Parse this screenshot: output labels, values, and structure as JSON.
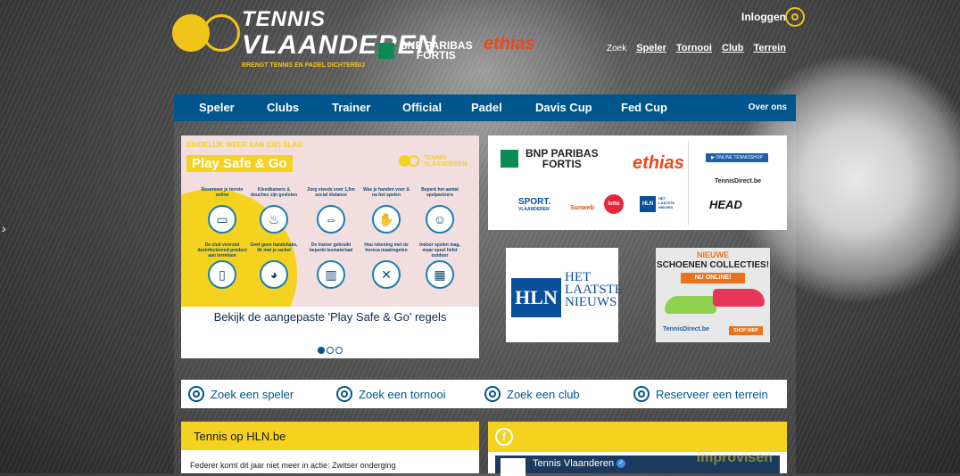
{
  "header": {
    "logo": {
      "line1": "TENNIS",
      "line2": "VLAANDEREN",
      "tagline": "BRENGT TENNIS EN PADEL DICHTERBIJ"
    },
    "sponsor_bnp": {
      "line1": "BNP PARIBAS",
      "line2": "FORTIS"
    },
    "sponsor_ethias": "ethias",
    "login_label": "Inloggen",
    "search_label": "Zoek",
    "search_links": [
      "Speler",
      "Tornooi",
      "Club",
      "Terrein"
    ]
  },
  "nav": {
    "items": [
      "Speler",
      "Clubs",
      "Trainer",
      "Official",
      "Padel",
      "Davis Cup",
      "Fed Cup"
    ],
    "right": "Over ons"
  },
  "slider": {
    "kicker": "EINDELIJK WEER AAN (DE) SLAG",
    "title": "Play Safe & Go",
    "logo_text": [
      "TENNIS",
      "VLAANDEREN"
    ],
    "icons": [
      {
        "caption": "Reserveer je terrein online",
        "icon": "screen-icon"
      },
      {
        "caption": "Kleedkamers & douches zijn gesloten",
        "icon": "shower-icon"
      },
      {
        "caption": "Zorg steeds voor 1,5m social distance",
        "icon": "distance-icon"
      },
      {
        "caption": "Was je handen voor & na het spelen",
        "icon": "hands-icon"
      },
      {
        "caption": "Beperk het aantal spelpartners",
        "icon": "players-icon"
      },
      {
        "caption": "De club voorziet desinfecterend product aan terreinen",
        "icon": "bottle-icon"
      },
      {
        "caption": "Geef geen handshake, tik met je racket",
        "icon": "racket-icon"
      },
      {
        "caption": "De trainer gebruikt beperkt lesmateriaal",
        "icon": "basket-icon"
      },
      {
        "caption": "Hou rekening met de horeca maatregelen",
        "icon": "cutlery-icon"
      },
      {
        "caption": "Indoor spelen mag, maar speel liefst outdoor",
        "icon": "court-icon"
      }
    ],
    "icon_glyphs": [
      "▭",
      "♨",
      "⇔",
      "✋",
      "☺",
      "▯",
      "◕",
      "▥",
      "✕",
      "▦"
    ],
    "caption": "Bekijk de aangepaste 'Play Safe & Go' regels"
  },
  "sponsors": {
    "bnp": {
      "line1": "BNP PARIBAS",
      "line2": "FORTIS"
    },
    "ethias": "ethias",
    "shop_button": "▶ ONLINE TENNISSHOP",
    "tennisdirect": "TennisDirect.be",
    "sport": {
      "line1": "SPORT.",
      "line2": "VLAANDEREN"
    },
    "sunweb": "Sunweb",
    "lotto": "lotto",
    "hln_small": "HLN",
    "hln_small_words": [
      "HET",
      "LAATSTE",
      "NIEUWS"
    ],
    "head": "HEAD"
  },
  "ads": {
    "hln": {
      "box": "HLN",
      "words": [
        "HET",
        "LAATSTE",
        "NIEUWS"
      ]
    },
    "shoes": {
      "line1": "NIEUWE",
      "line2": "SCHOENEN COLLECTIES!",
      "badge": "NU ONLINE!",
      "brand": "TennisDirect.be",
      "cta": "SHOP HIER"
    }
  },
  "quick_search": [
    "Zoek een speler",
    "Zoek een tornooi",
    "Zoek een club",
    "Reserveer een terrein"
  ],
  "hln_card": {
    "title": "Tennis op HLN.be",
    "article": "Federer komt dit jaar niet meer in actie: Zwitser onderging"
  },
  "facebook": {
    "icon": "f",
    "page_name": "Tennis Vlaanderen",
    "overlay": "improvisen"
  },
  "colors": {
    "nav_blue": "#00558c",
    "brand_yellow": "#f4d21f",
    "ethias_orange": "#e84a1c"
  }
}
